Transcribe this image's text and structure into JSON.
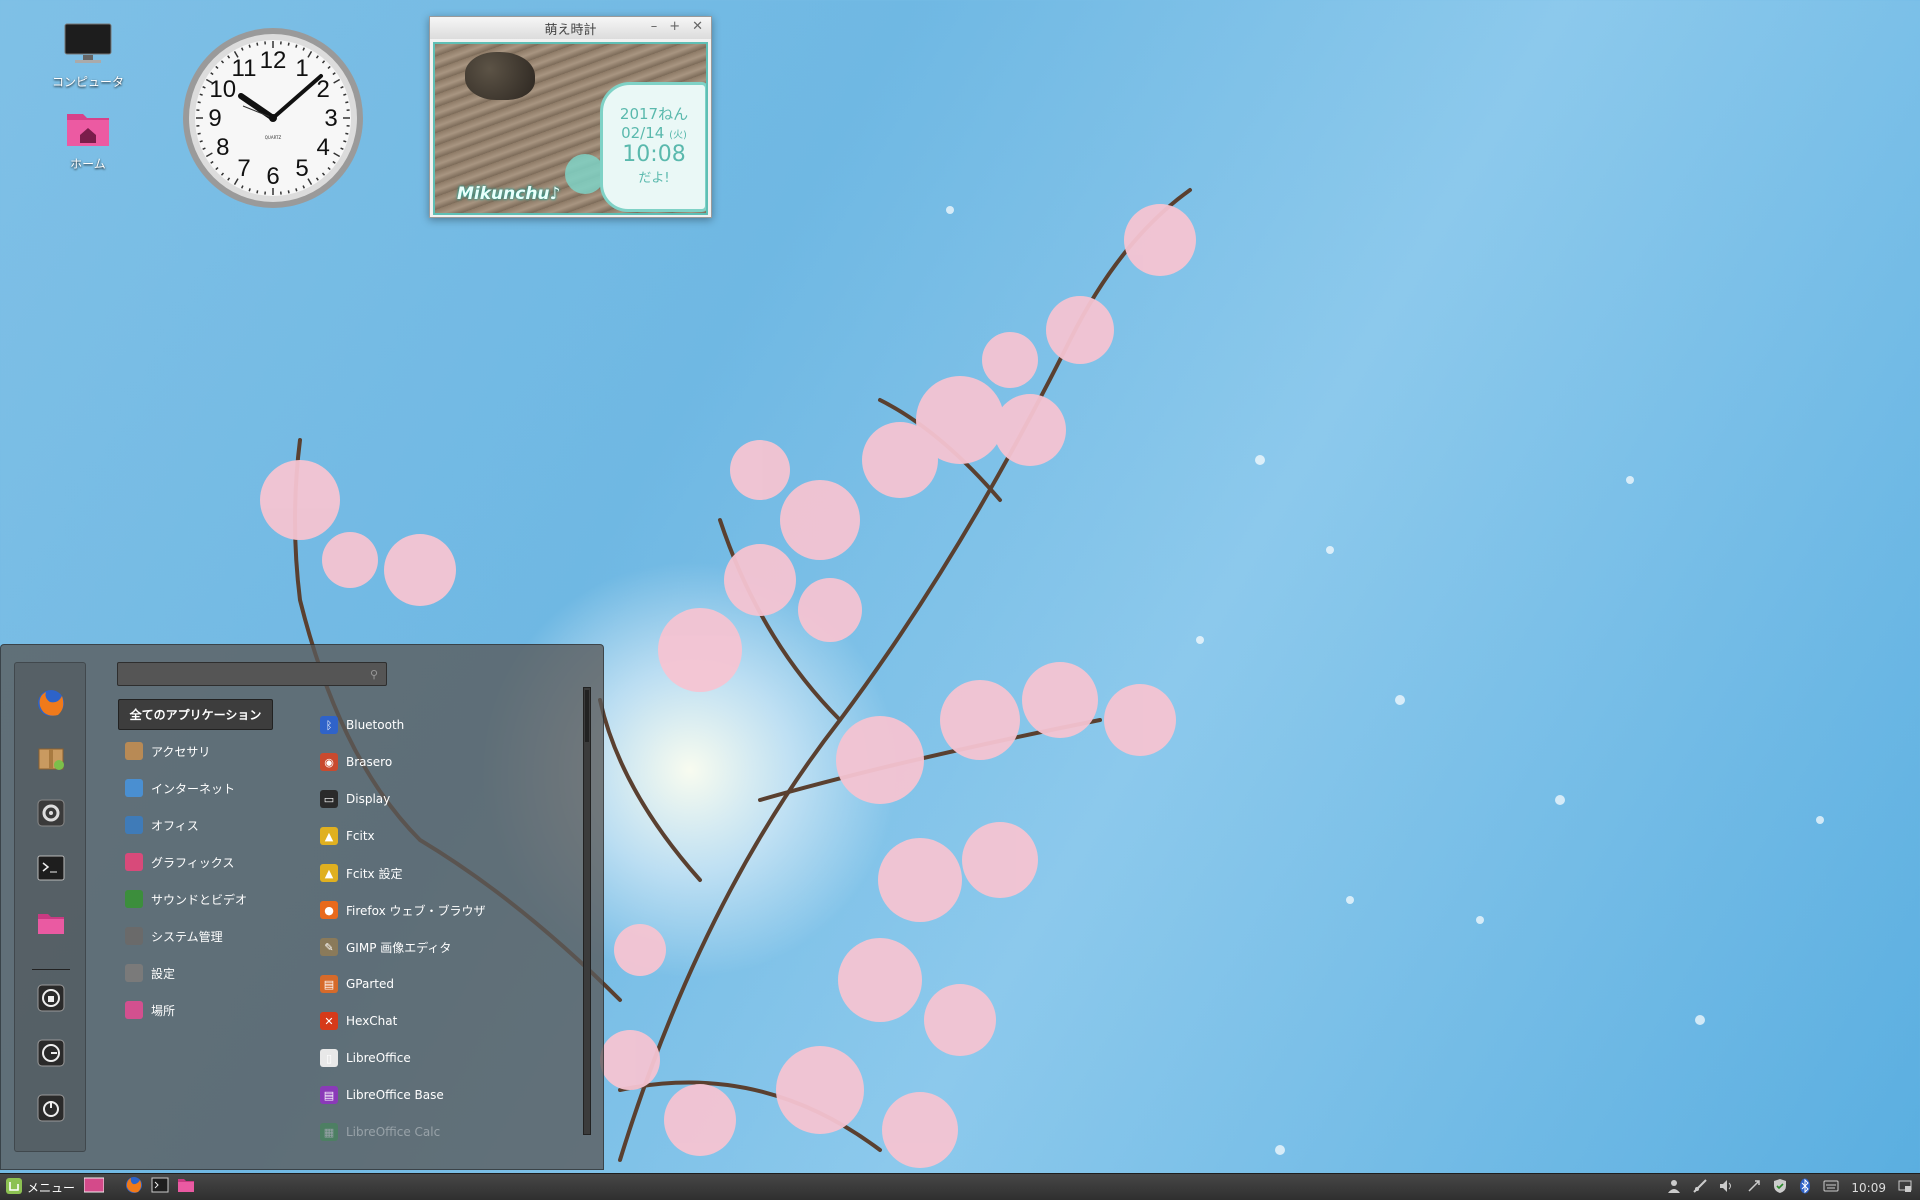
{
  "desktop": {
    "icons": [
      {
        "label": "コンピュータ",
        "icon": "computer-icon"
      },
      {
        "label": "ホーム",
        "icon": "home-folder-icon"
      }
    ]
  },
  "analog_clock": {
    "numbers": [
      "12",
      "1",
      "2",
      "3",
      "4",
      "5",
      "6",
      "7",
      "8",
      "9",
      "10",
      "11"
    ],
    "brand": "QUARTZ"
  },
  "moe_clock": {
    "title": "萌え時計",
    "controls": [
      "–",
      "+",
      "✕"
    ],
    "year": "2017ねん",
    "date": "02/14",
    "weekday": "(火)",
    "time": "10:08",
    "dayo": "だよ!",
    "brand": "Mikunchu♪"
  },
  "menu": {
    "search": {
      "placeholder": ""
    },
    "favorites": [
      {
        "icon": "firefox-icon"
      },
      {
        "icon": "software-manager-icon"
      },
      {
        "icon": "system-settings-icon"
      },
      {
        "icon": "terminal-icon"
      },
      {
        "icon": "folder-icon"
      },
      {
        "icon": "lock-screen-icon"
      },
      {
        "icon": "logout-icon"
      },
      {
        "icon": "power-icon"
      }
    ],
    "categories_all": "全てのアプリケーション",
    "categories": [
      {
        "label": "アクセサリ",
        "color": "#b88a55"
      },
      {
        "label": "インターネット",
        "color": "#4a8fd1"
      },
      {
        "label": "オフィス",
        "color": "#3f7bb8"
      },
      {
        "label": "グラフィックス",
        "color": "#d84a7a"
      },
      {
        "label": "サウンドとビデオ",
        "color": "#3c8e3c"
      },
      {
        "label": "システム管理",
        "color": "#6a6a6a"
      },
      {
        "label": "設定",
        "color": "#7a7a7a"
      },
      {
        "label": "場所",
        "color": "#d3508f"
      }
    ],
    "apps": [
      {
        "label": "Bluetooth",
        "color": "#2f63c9",
        "glyph": "ᛒ"
      },
      {
        "label": "Brasero",
        "color": "#c94a2f",
        "glyph": "◉"
      },
      {
        "label": "Display",
        "color": "#2a2a2a",
        "glyph": "▭"
      },
      {
        "label": "Fcitx",
        "color": "#e0b020",
        "glyph": "▲"
      },
      {
        "label": "Fcitx 設定",
        "color": "#e0b020",
        "glyph": "▲"
      },
      {
        "label": "Firefox ウェブ・ブラウザ",
        "color": "#e86a1c",
        "glyph": "●"
      },
      {
        "label": "GIMP 画像エディタ",
        "color": "#8a7a5a",
        "glyph": "✎"
      },
      {
        "label": "GParted",
        "color": "#d66a2a",
        "glyph": "▤"
      },
      {
        "label": "HexChat",
        "color": "#d63a1a",
        "glyph": "✕"
      },
      {
        "label": "LibreOffice",
        "color": "#e8e8e8",
        "glyph": "▯"
      },
      {
        "label": "LibreOffice Base",
        "color": "#8a3ab8",
        "glyph": "▤"
      },
      {
        "label": "LibreOffice Calc",
        "color": "#2e9e3e",
        "glyph": "▦"
      }
    ]
  },
  "taskbar": {
    "menu_label": "メニュー",
    "time": "10:09"
  }
}
